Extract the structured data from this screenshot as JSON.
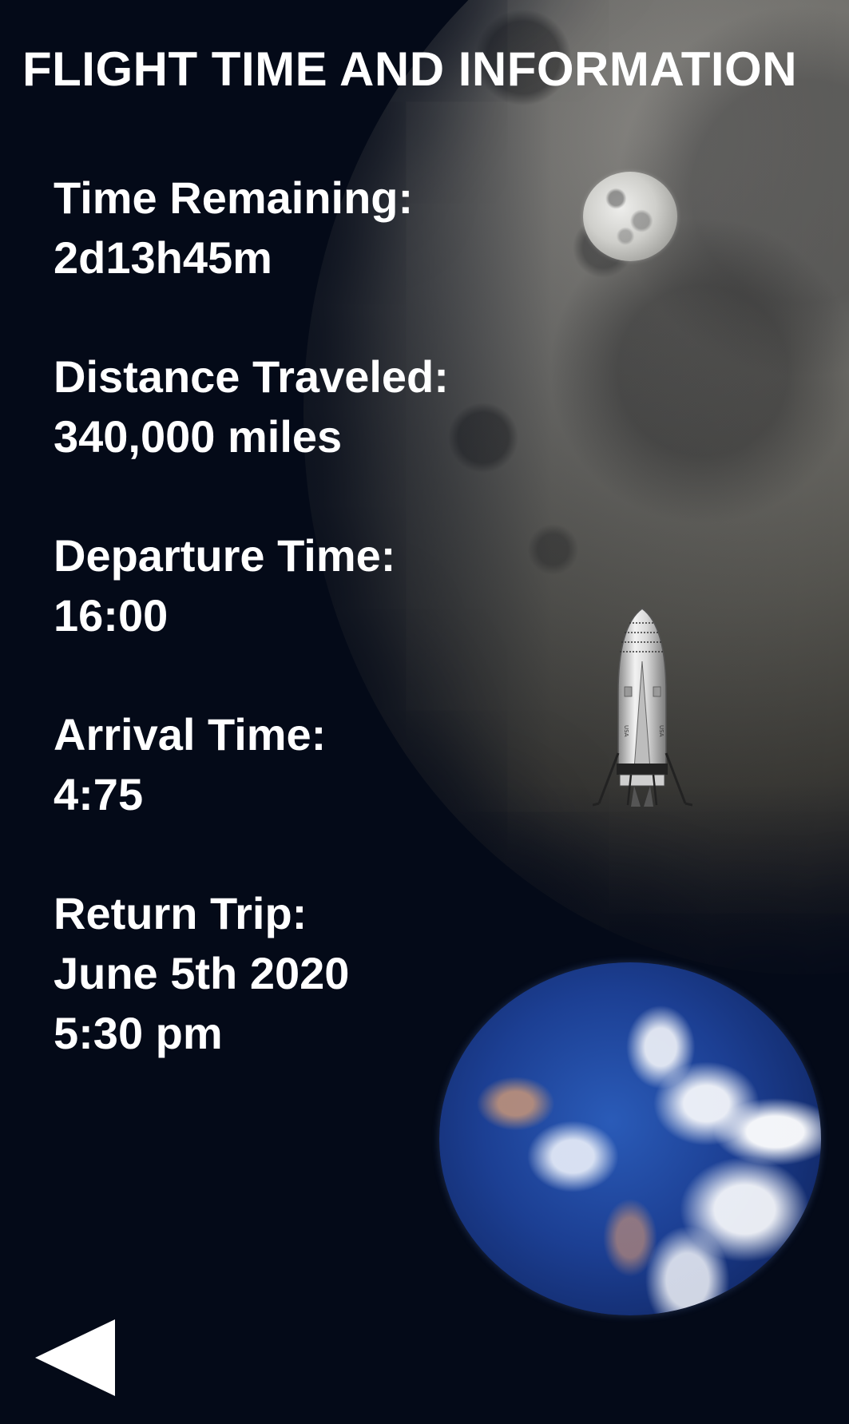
{
  "header": {
    "title": "FLIGHT TIME AND INFORMATION"
  },
  "info": [
    {
      "label": "Time Remaining:",
      "value": "2d13h45m"
    },
    {
      "label": "Distance Traveled:",
      "value": "340,000 miles"
    },
    {
      "label": "Departure Time:",
      "value": "16:00"
    },
    {
      "label": "Arrival Time:",
      "value": "4:75"
    },
    {
      "label": "Return Trip:",
      "value": "June 5th 2020",
      "value2": "5:30 pm"
    }
  ],
  "icons": {
    "small_moon": "moon-icon",
    "rocket": "rocket-icon",
    "earth": "earth-icon",
    "back": "back-arrow-icon"
  },
  "rocket_marking": "USA",
  "colors": {
    "background": "#040a18",
    "text": "#ffffff"
  }
}
